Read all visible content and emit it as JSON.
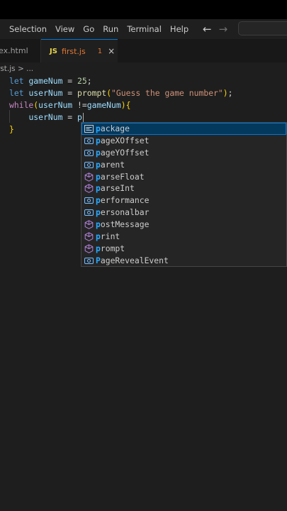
{
  "menu": [
    "Selection",
    "View",
    "Go",
    "Run",
    "Terminal",
    "Help"
  ],
  "nav": {
    "back_icon": "arrow-left-icon",
    "forward_icon": "arrow-right-icon",
    "back": "←",
    "forward": "→"
  },
  "tabs": {
    "inactive": {
      "label": "ex.html"
    },
    "active": {
      "badge": "JS",
      "label": "first.js",
      "problems": "1",
      "close": "×"
    }
  },
  "breadcrumb": "rst.js > ...",
  "code": {
    "line1": {
      "kw": "let",
      "var": "gameNum",
      "op": " = ",
      "num": "25",
      "end": ";"
    },
    "line2": {
      "kw": "let",
      "var": "userNum",
      "op": " = ",
      "fn": "prompt",
      "open": "(",
      "str": "\"Guess the game number\"",
      "close": ")",
      "end": ";"
    },
    "line3": {
      "kw": "while",
      "open": "(",
      "var1": "userNum",
      "op": " !=",
      "var2": "gameNum",
      "close": ")",
      "brace": "{"
    },
    "line4": {
      "indent": "    ",
      "var": "userNum",
      "op": " = ",
      "typed": "p"
    },
    "line5": {
      "brace": "}"
    }
  },
  "suggestions": [
    {
      "rest": "ackage",
      "kind": "keyword",
      "selected": true
    },
    {
      "rest": "ageXOffset",
      "kind": "variable"
    },
    {
      "rest": "ageYOffset",
      "kind": "variable"
    },
    {
      "rest": "arent",
      "kind": "variable"
    },
    {
      "rest": "arseFloat",
      "kind": "function"
    },
    {
      "rest": "arseInt",
      "kind": "function"
    },
    {
      "rest": "erformance",
      "kind": "variable"
    },
    {
      "rest": "ersonalbar",
      "kind": "variable"
    },
    {
      "rest": "ostMessage",
      "kind": "function"
    },
    {
      "rest": "rint",
      "kind": "function"
    },
    {
      "rest": "rompt",
      "kind": "function"
    },
    {
      "rest": "ageRevealEvent",
      "kind": "variable",
      "first": "P"
    }
  ],
  "suggestions_prefix": "p",
  "colors": {
    "accent": "#0078d4",
    "match": "#2aaaff",
    "selection": "#04395e",
    "tab_modified": "#e37933"
  }
}
